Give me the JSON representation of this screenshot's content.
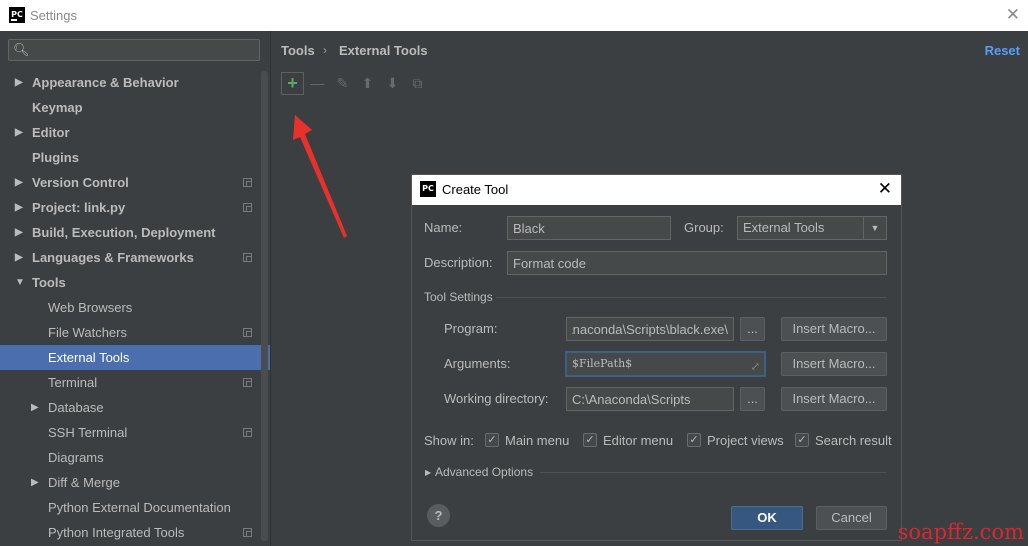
{
  "window": {
    "title": "Settings",
    "logo": "PC",
    "close_glyph": "✕"
  },
  "search": {
    "icon": "search-icon",
    "value": ""
  },
  "sidebar": {
    "items": [
      {
        "label": "Appearance & Behavior",
        "level": 0,
        "arrow": "▶",
        "bold": true
      },
      {
        "label": "Keymap",
        "level": 0,
        "arrow": "",
        "bold": true
      },
      {
        "label": "Editor",
        "level": 0,
        "arrow": "▶",
        "bold": true
      },
      {
        "label": "Plugins",
        "level": 0,
        "arrow": "",
        "bold": true
      },
      {
        "label": "Version Control",
        "level": 0,
        "arrow": "▶",
        "bold": true,
        "page_icon": true
      },
      {
        "label": "Project: link.py",
        "level": 0,
        "arrow": "▶",
        "bold": true,
        "page_icon": true
      },
      {
        "label": "Build, Execution, Deployment",
        "level": 0,
        "arrow": "▶",
        "bold": true
      },
      {
        "label": "Languages & Frameworks",
        "level": 0,
        "arrow": "▶",
        "bold": true,
        "page_icon": true
      },
      {
        "label": "Tools",
        "level": 0,
        "arrow": "▼",
        "bold": true
      },
      {
        "label": "Web Browsers",
        "level": 1,
        "arrow": ""
      },
      {
        "label": "File Watchers",
        "level": 1,
        "arrow": "",
        "page_icon": true
      },
      {
        "label": "External Tools",
        "level": 1,
        "arrow": "",
        "selected": true
      },
      {
        "label": "Terminal",
        "level": 1,
        "arrow": "",
        "page_icon": true
      },
      {
        "label": "Database",
        "level": 1,
        "arrow": "▶"
      },
      {
        "label": "SSH Terminal",
        "level": 1,
        "arrow": "",
        "page_icon": true
      },
      {
        "label": "Diagrams",
        "level": 1,
        "arrow": ""
      },
      {
        "label": "Diff & Merge",
        "level": 1,
        "arrow": "▶"
      },
      {
        "label": "Python External Documentation",
        "level": 1,
        "arrow": ""
      },
      {
        "label": "Python Integrated Tools",
        "level": 1,
        "arrow": "",
        "page_icon": true
      }
    ]
  },
  "content": {
    "breadcrumb": [
      "Tools",
      "External Tools"
    ],
    "breadcrumb_sep": "›",
    "reset_label": "Reset",
    "toolbar": {
      "add": "+",
      "remove": "—",
      "edit": "✎",
      "up": "⬆",
      "down": "⬇",
      "copy": "⧉"
    }
  },
  "dialog": {
    "title": "Create Tool",
    "logo": "PC",
    "close_glyph": "✕",
    "name_label": "Name:",
    "name_value": "Black",
    "group_label": "Group:",
    "group_value": "External Tools",
    "group_arrow": "▼",
    "description_label": "Description:",
    "description_value": "Format code",
    "tool_settings_label": "Tool Settings",
    "program_label": "Program:",
    "program_value": "\\Anaconda\\Scripts\\black.exe",
    "arguments_label": "Arguments:",
    "arguments_value": "$FilePath$",
    "workdir_label": "Working directory:",
    "workdir_value": "C:\\Anaconda\\Scripts",
    "browse_label": "...",
    "insert_macro_label": "Insert Macro...",
    "show_in_label": "Show in:",
    "check_glyph": "✓",
    "checkboxes": [
      {
        "label": "Main menu",
        "checked": true
      },
      {
        "label": "Editor menu",
        "checked": true
      },
      {
        "label": "Project views",
        "checked": true
      },
      {
        "label": "Search result",
        "checked": true
      }
    ],
    "advanced_label": "Advanced Options",
    "help_label": "?",
    "ok_label": "OK",
    "cancel_label": "Cancel"
  },
  "colors": {
    "accent": "#4b6eaf",
    "link": "#589df6",
    "arrow": "#e8312a",
    "watermark": "#d9282f",
    "add": "#59a869"
  },
  "watermark": "soapffz.com"
}
